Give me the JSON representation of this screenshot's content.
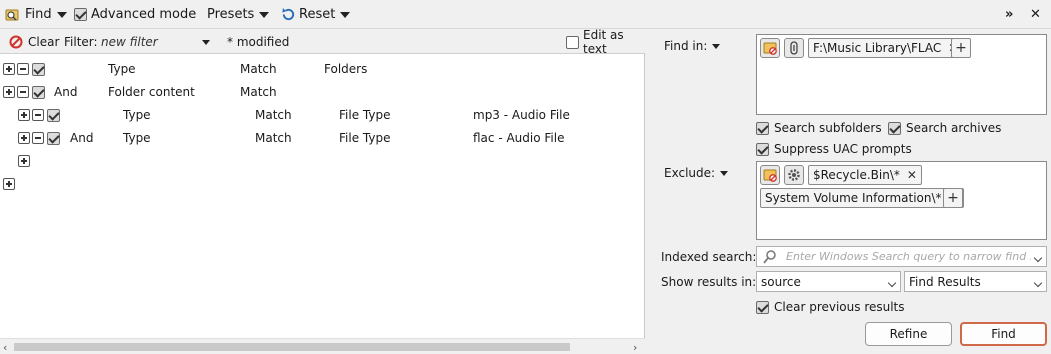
{
  "toolbar": {
    "find_label": "Find",
    "advanced_mode_label": "Advanced mode",
    "advanced_mode_checked": true,
    "presets_label": "Presets",
    "reset_label": "Reset"
  },
  "filter_bar": {
    "clear_label": "Clear",
    "filter_label": "Filter:",
    "filter_placeholder": "new filter",
    "modified_label": "* modified",
    "edit_as_text_label": "Edit as text",
    "edit_as_text_checked": false
  },
  "rules": [
    {
      "level": 0,
      "connector": "",
      "field": "Type",
      "op": "Match",
      "value": "Folders",
      "extra": ""
    },
    {
      "level": 0,
      "connector": "And",
      "field": "Folder content",
      "op": "Match",
      "value": "",
      "extra": ""
    },
    {
      "level": 1,
      "connector": "",
      "field": "Type",
      "op": "Match",
      "value": "File Type",
      "extra": "mp3 - Audio File"
    },
    {
      "level": 1,
      "connector": "And",
      "field": "Type",
      "op": "Match",
      "value": "File Type",
      "extra": "flac - Audio File"
    }
  ],
  "find_in": {
    "label": "Find in:",
    "path": "F:\\Music Library\\FLAC",
    "search_subfolders": "Search subfolders",
    "search_archives": "Search archives",
    "suppress_uac": "Suppress UAC prompts"
  },
  "exclude": {
    "label": "Exclude:",
    "items": [
      "$Recycle.Bin\\*",
      "System Volume Information\\*"
    ]
  },
  "indexed_search": {
    "label": "Indexed search:",
    "placeholder": "Enter Windows Search query to narrow find ..."
  },
  "show_results": {
    "label": "Show results in:",
    "location_value": "source",
    "target_value": "Find Results"
  },
  "clear_previous_label": "Clear previous results",
  "buttons": {
    "refine": "Refine",
    "find": "Find"
  }
}
